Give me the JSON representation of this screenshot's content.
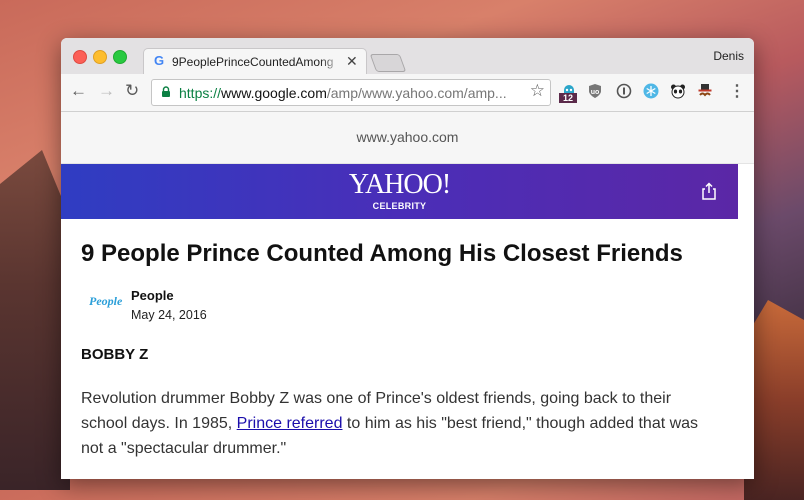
{
  "browser": {
    "tab_title": "9PeoplePrinceCountedAmong",
    "tab_favicon": "G",
    "profile_name": "Denis",
    "url_scheme": "https://",
    "url_host": "www.google.com",
    "url_path": "/amp/www.yahoo.com/amp...",
    "extension_badge": "12",
    "icons": [
      "back-arrow-icon",
      "forward-arrow-icon",
      "reload-icon",
      "lock-icon",
      "star-icon",
      "ghostery-icon",
      "ublock-shield-icon",
      "1password-icon",
      "snowflake-icon",
      "panda-icon",
      "hat-mustache-icon",
      "menu-icon"
    ]
  },
  "page": {
    "amp_domain": "www.yahoo.com",
    "brand_logo": "YAHOO!",
    "brand_sub": "CELEBRITY",
    "headline": "9 People Prince Counted Among His Closest Friends",
    "publisher_logo": "People",
    "author": "People",
    "date": "May 24, 2016",
    "section_heading": "BOBBY Z",
    "para_before": "Revolution drummer Bobby Z was one of Prince's oldest friends, going back to their school days. In 1985, ",
    "para_link": "Prince referred",
    "para_after": " to him as his \"best friend,\" though added that was not a \"spectacular drummer.\""
  },
  "colors": {
    "yahoo_gradient_start": "#2f3dc2",
    "yahoo_gradient_end": "#5b27a6",
    "url_secure": "#0b8043",
    "link": "#1a0dab"
  }
}
